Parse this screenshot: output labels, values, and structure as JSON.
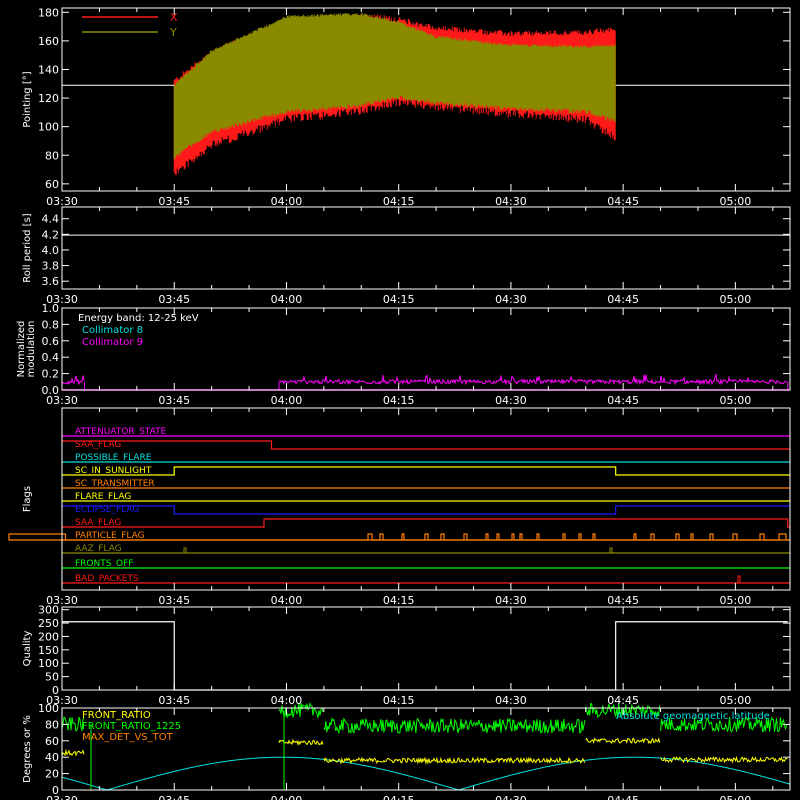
{
  "colors": {
    "background": "#000000",
    "axes": "#ffffff",
    "x_red": "#ff1a1a",
    "y_olive": "#8a8a00",
    "cyan": "#00e0e0",
    "magenta": "#ff00ff",
    "yellow": "#ffff00",
    "green": "#00ff00",
    "orange": "#ff8000",
    "blue": "#1a1aff"
  },
  "time_ticks": [
    "03:30",
    "03:45",
    "04:00",
    "04:15",
    "04:30",
    "04:45",
    "05:00"
  ],
  "chart_data": [
    {
      "id": "pointing",
      "type": "line",
      "ylabel": "Pointing [°]",
      "ylim": [
        55,
        183
      ],
      "yticks": [
        60,
        80,
        100,
        120,
        140,
        160,
        180
      ],
      "legend": [
        {
          "name": "X",
          "color": "#ff1a1a"
        },
        {
          "name": "Y",
          "color": "#8a8a00"
        }
      ],
      "reference_line": 129,
      "series": [
        {
          "name": "X",
          "x": [
            "03:45",
            "03:50",
            "04:00",
            "04:10",
            "04:15",
            "04:20",
            "04:30",
            "04:40",
            "04:44"
          ],
          "upper": [
            130,
            150,
            172,
            176,
            173,
            167,
            163,
            164,
            166
          ],
          "lower": [
            70,
            90,
            108,
            114,
            120,
            117,
            112,
            108,
            95
          ]
        },
        {
          "name": "Y",
          "x": [
            "03:45",
            "03:50",
            "04:00",
            "04:10",
            "04:15",
            "04:20",
            "04:30",
            "04:40",
            "04:44"
          ],
          "upper": [
            128,
            152,
            176,
            178,
            172,
            162,
            156,
            155,
            156
          ],
          "lower": [
            80,
            98,
            112,
            116,
            122,
            118,
            114,
            112,
            105
          ]
        }
      ]
    },
    {
      "id": "roll",
      "type": "line",
      "ylabel": "Roll period [s]",
      "ylim": [
        3.5,
        4.55
      ],
      "yticks": [
        3.6,
        3.8,
        4.0,
        4.2,
        4.4
      ],
      "series": [
        {
          "name": "",
          "x": [
            "03:30",
            "05:07"
          ],
          "values": [
            4.19,
            4.19
          ]
        }
      ]
    },
    {
      "id": "modulation",
      "type": "line",
      "ylabel": "Normalized modulation",
      "ylim": [
        0,
        1.0
      ],
      "yticks": [
        0.0,
        0.2,
        0.4,
        0.6,
        0.8,
        1.0
      ],
      "annotation": "Energy band: 12-25 keV",
      "legend": [
        {
          "name": "Collimator 8",
          "color": "#00e0e0"
        },
        {
          "name": "Collimator 9",
          "color": "#ff00ff"
        }
      ],
      "series": [
        {
          "name": "Collimator 9",
          "segments": [
            [
              "03:30",
              "03:33",
              0.1
            ],
            [
              "03:59",
              "05:07",
              0.1
            ]
          ]
        }
      ]
    },
    {
      "id": "flags",
      "type": "line",
      "ylabel": "Flags",
      "flags": [
        {
          "name": "ATTENUATOR_STATE",
          "color": "#ff00ff",
          "steps": []
        },
        {
          "name": "SAA_FLAG",
          "color": "#ff1a1a",
          "steps": [
            [
              "03:30",
              1
            ],
            [
              "03:58",
              0
            ]
          ]
        },
        {
          "name": "POSSIBLE_FLARE",
          "color": "#00e0e0",
          "steps": []
        },
        {
          "name": "SC_IN_SUNLIGHT",
          "color": "#ffff00",
          "steps": [
            [
              "03:30",
              0
            ],
            [
              "03:45",
              1
            ],
            [
              "04:44",
              0
            ]
          ]
        },
        {
          "name": "SC_TRANSMITTER",
          "color": "#ff8000",
          "steps": []
        },
        {
          "name": "FLARE_FLAG",
          "color": "#ffff00",
          "steps": []
        },
        {
          "name": "ECLIPSE_FLAG",
          "color": "#1a1aff",
          "steps": [
            [
              "03:30",
              1
            ],
            [
              "03:45",
              0
            ],
            [
              "04:44",
              1
            ]
          ]
        },
        {
          "name": "SAA_FLAG",
          "color": "#ff1a1a",
          "steps": [
            [
              "03:30",
              0
            ],
            [
              "03:57",
              1
            ],
            [
              "05:07",
              0
            ]
          ]
        },
        {
          "name": "PARTICLE_FLAG",
          "color": "#ff8000",
          "steps": []
        },
        {
          "name": "AAZ_FLAG",
          "color": "#8a8a00",
          "steps": []
        },
        {
          "name": "FRONTS_OFF",
          "color": "#00ff00",
          "steps": []
        },
        {
          "name": "BAD_PACKETS",
          "color": "#ff1a1a",
          "steps": []
        }
      ]
    },
    {
      "id": "quality",
      "type": "line",
      "ylabel": "Quality",
      "ylim": [
        0,
        310
      ],
      "yticks": [
        0,
        50,
        100,
        150,
        200,
        250,
        300
      ],
      "series": [
        {
          "name": "",
          "x": [
            "03:30",
            "03:45",
            "03:45",
            "04:44",
            "04:44",
            "05:07"
          ],
          "values": [
            255,
            255,
            0,
            0,
            255,
            255
          ]
        }
      ]
    },
    {
      "id": "front",
      "type": "line",
      "ylabel": "Degrees or %",
      "ylim": [
        0,
        100
      ],
      "yticks": [
        0,
        20,
        40,
        60,
        80,
        100
      ],
      "legend": [
        {
          "name": "FRONT_RATIO",
          "color": "#ffff00"
        },
        {
          "name": "FRONT_RATIO_1225",
          "color": "#00ff00"
        },
        {
          "name": "MAX_DET_VS_TOT",
          "color": "#ff8000"
        },
        {
          "name": "Absolute geomagnetic latitude",
          "color": "#00e0e0"
        }
      ]
    }
  ]
}
